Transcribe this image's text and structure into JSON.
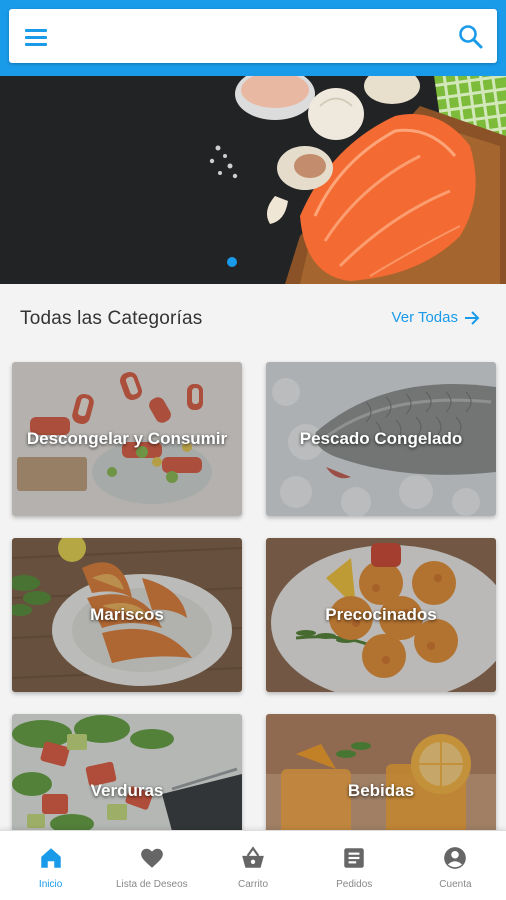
{
  "header": {
    "menu_icon": "hamburger-menu-icon",
    "search_icon": "search-icon",
    "accent_color": "#1a9bea"
  },
  "hero": {
    "image": "salmon-on-cutting-board-with-garlic-and-salt",
    "carousel_pages": 1,
    "carousel_active": 1
  },
  "categories_section": {
    "title": "Todas las Categorías",
    "see_all_label": "Ver Todas",
    "see_all_icon": "arrow-right-icon"
  },
  "categories": [
    {
      "label": "Descongelar y Consumir",
      "image": "crab-sticks-salad"
    },
    {
      "label": "Pescado Congelado",
      "image": "fish-on-ice"
    },
    {
      "label": "Mariscos",
      "image": "grilled-shrimps"
    },
    {
      "label": "Precocinados",
      "image": "croquettes"
    },
    {
      "label": "Verduras",
      "image": "salad"
    },
    {
      "label": "Bebidas",
      "image": "orange-drinks"
    }
  ],
  "bottom_nav": [
    {
      "label": "Inicio",
      "icon": "home-icon",
      "active": true
    },
    {
      "label": "Lista de Deseos",
      "icon": "heart-icon",
      "active": false
    },
    {
      "label": "Carrito",
      "icon": "basket-icon",
      "active": false
    },
    {
      "label": "Pedidos",
      "icon": "document-icon",
      "active": false
    },
    {
      "label": "Cuenta",
      "icon": "account-icon",
      "active": false
    }
  ]
}
